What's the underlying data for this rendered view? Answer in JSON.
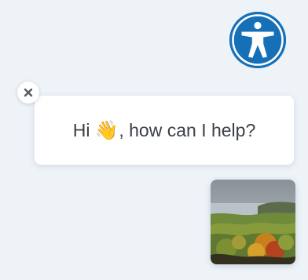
{
  "accessibility_button": {
    "icon": "accessibility-person-icon",
    "color": "#1670b8"
  },
  "greeting": {
    "text_before": "Hi",
    "emoji": "👋",
    "emoji_icon": "waving-hand-icon",
    "text_after": ", how can I help?"
  },
  "close_button": {
    "icon": "close-icon"
  },
  "avatar": {
    "icon": "landscape-photo-avatar"
  }
}
